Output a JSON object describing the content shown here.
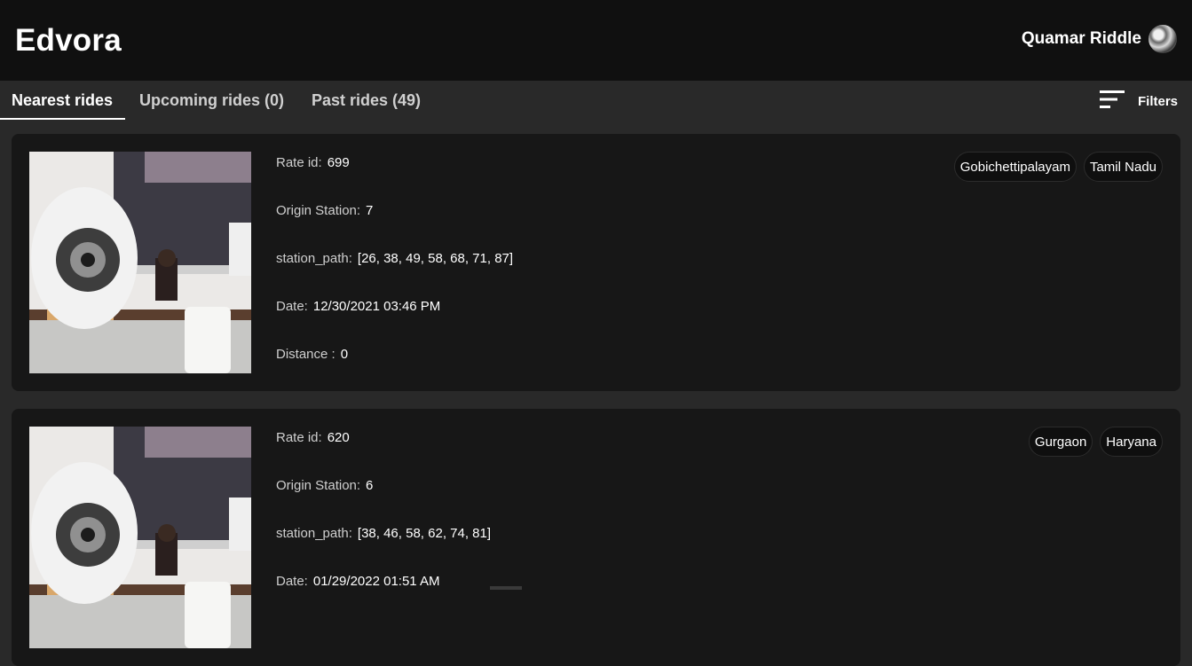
{
  "header": {
    "brand": "Edvora",
    "user_name": "Quamar Riddle",
    "avatar_icon": "avatar-image"
  },
  "tabs": [
    {
      "label": "Nearest rides",
      "active": true
    },
    {
      "label": "Upcoming rides (0)",
      "active": false
    },
    {
      "label": "Past rides (49)",
      "active": false
    }
  ],
  "filters": {
    "label": "Filters",
    "icon": "filter-lines-icon"
  },
  "field_labels": {
    "rate_id": "Rate id:",
    "origin_station": "Origin Station:",
    "station_path": "station_path:",
    "date": "Date:",
    "distance": "Distance :"
  },
  "rides": [
    {
      "rate_id": "699",
      "origin_station": "7",
      "station_path": "[26, 38, 49, 58, 68, 71, 87]",
      "date": "12/30/2021 03:46 PM",
      "distance": "0",
      "city": "Gobichettipalayam",
      "state": "Tamil Nadu"
    },
    {
      "rate_id": "620",
      "origin_station": "6",
      "station_path": "[38, 46, 58, 62, 74, 81]",
      "date": "01/29/2022 01:51 AM",
      "distance": "",
      "city": "Gurgaon",
      "state": "Haryana"
    }
  ]
}
